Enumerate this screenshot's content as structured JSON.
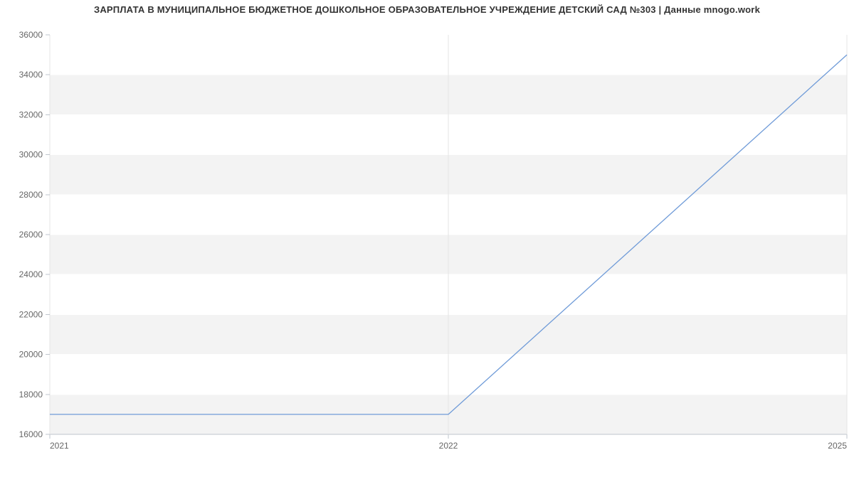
{
  "title": "ЗАРПЛАТА В МУНИЦИПАЛЬНОЕ БЮДЖЕТНОЕ ДОШКОЛЬНОЕ ОБРАЗОВАТЕЛЬНОЕ УЧРЕЖДЕНИЕ ДЕТСКИЙ САД №303 | Данные mnogo.work",
  "chart_data": {
    "type": "line",
    "title": "ЗАРПЛАТА В МУНИЦИПАЛЬНОЕ БЮДЖЕТНОЕ ДОШКОЛЬНОЕ ОБРАЗОВАТЕЛЬНОЕ УЧРЕЖДЕНИЕ ДЕТСКИЙ САД №303 | Данные mnogo.work",
    "x": [
      2021,
      2022,
      2025
    ],
    "values": [
      17000,
      17000,
      35000
    ],
    "x_ticks": [
      2021,
      2022,
      2025
    ],
    "y_ticks": [
      16000,
      18000,
      20000,
      22000,
      24000,
      26000,
      28000,
      30000,
      32000,
      34000,
      36000
    ],
    "xlabel": "",
    "ylabel": "",
    "xlim": [
      2021,
      2025
    ],
    "ylim": [
      16000,
      36000
    ],
    "grid": true,
    "series_color": "#6f9bd8"
  }
}
